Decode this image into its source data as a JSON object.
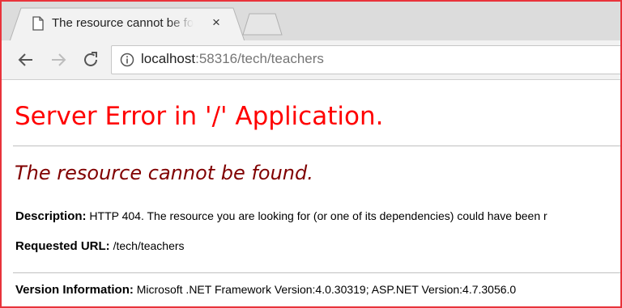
{
  "browser": {
    "tab_title": "The resource cannot be found.",
    "tab_close": "×",
    "url_host": "localhost",
    "url_rest": ":58316/tech/teachers"
  },
  "page": {
    "server_error_title": "Server Error in '/' Application.",
    "error_heading": "The resource cannot be found.",
    "description_label": "Description:",
    "description_text": "HTTP 404. The resource you are looking for (or one of its dependencies) could have been r",
    "requested_url_label": "Requested URL:",
    "requested_url_value": "/tech/teachers",
    "version_label": "Version Information:",
    "version_value": "Microsoft .NET Framework Version:4.0.30319; ASP.NET Version:4.7.3056.0"
  },
  "colors": {
    "frame_border": "#e8333b",
    "title_red": "#ff0000",
    "heading_maroon": "#800000"
  },
  "icons": [
    "document-icon",
    "close-icon",
    "back-icon",
    "forward-icon",
    "reload-icon",
    "info-icon"
  ]
}
